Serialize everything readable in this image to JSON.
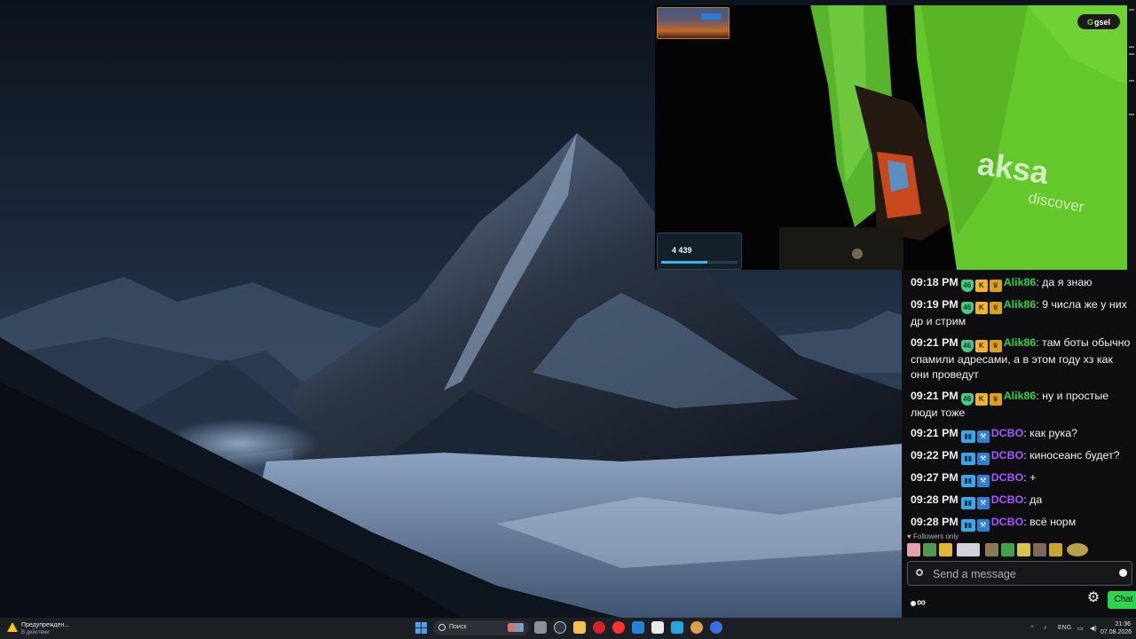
{
  "player": {
    "logo_g": "G",
    "logo_text": "gsel",
    "widget_value": "4 439",
    "banner_text": "aksa",
    "banner_sub": "discover"
  },
  "chat": {
    "messages": [
      {
        "time": "09:18 PM",
        "user": "Alik86",
        "text": ": да я знаю"
      },
      {
        "time": "09:19 PM",
        "user": "Alik86",
        "text": ": 9 числа же у них др и стрим"
      },
      {
        "time": "09:21 PM",
        "user": "Alik86",
        "text": ": там боты обычно спамили адресами, а в этом году хз как они проведут"
      },
      {
        "time": "09:21 PM",
        "user": "Alik86",
        "text": ": ну и простые люди тоже"
      },
      {
        "time": "09:21 PM",
        "user": "DCBO",
        "text": ": как рука?"
      },
      {
        "time": "09:22 PM",
        "user": "DCBO",
        "text": ": киносеанс будет?"
      },
      {
        "time": "09:27 PM",
        "user": "DCBO",
        "text": ": +"
      },
      {
        "time": "09:28 PM",
        "user": "DCBO",
        "text": ": да"
      },
      {
        "time": "09:28 PM",
        "user": "DCBO",
        "text": ": всё норм"
      }
    ],
    "sub_badge": "46",
    "followers_only": "Followers only",
    "input_placeholder": "Send a message",
    "points": "∞",
    "chat_button": "Chat"
  },
  "taskbar": {
    "warning_title": "Предупрежден...",
    "warning_sub": "В действии",
    "search_placeholder": "Поиск",
    "lang": "ENG",
    "time": "21:36",
    "date": "07.08.2026"
  },
  "colors": {
    "alik": "#2ed34f",
    "dcbo": "#a458ff",
    "chat_bg": "#0e0e10",
    "chat_button": "#2ed34f"
  }
}
